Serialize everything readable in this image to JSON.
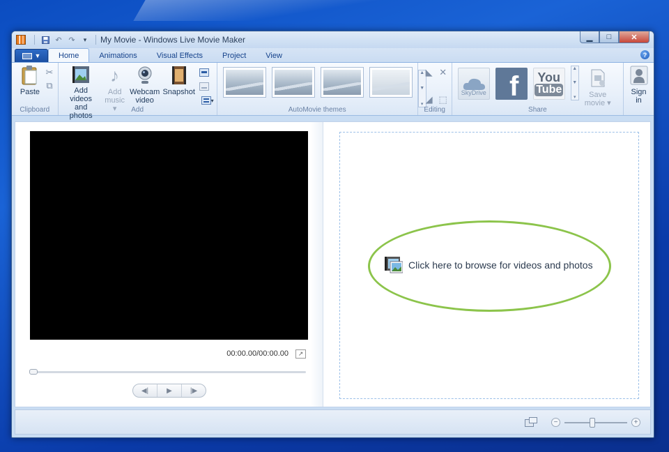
{
  "window": {
    "title": "My Movie - Windows Live Movie Maker"
  },
  "qat": {
    "icons": [
      "save-icon",
      "undo-icon",
      "redo-icon",
      "customize-qat-icon"
    ]
  },
  "tabs": [
    "Home",
    "Animations",
    "Visual Effects",
    "Project",
    "View"
  ],
  "ribbon": {
    "clipboard": {
      "label": "Clipboard",
      "paste": "Paste"
    },
    "add": {
      "label": "Add",
      "add_videos": "Add videos\nand photos",
      "add_videos_l1": "Add videos",
      "add_videos_l2": "and photos",
      "add_music_l1": "Add",
      "add_music_l2": "music",
      "webcam_l1": "Webcam",
      "webcam_l2": "video",
      "snapshot": "Snapshot"
    },
    "automovie": {
      "label": "AutoMovie themes"
    },
    "editing": {
      "label": "Editing"
    },
    "share": {
      "label": "Share",
      "skydrive": "SkyDrive",
      "facebook": "f",
      "youtube_l1": "You",
      "youtube_l2": "Tube",
      "save_movie_l1": "Save",
      "save_movie_l2": "movie"
    },
    "signin": {
      "l1": "Sign",
      "l2": "in"
    }
  },
  "preview": {
    "timecode": "00:00.00/00:00.00"
  },
  "storyboard": {
    "browse_text": "Click here to browse for videos and photos",
    "highlight_color": "#8cc44b"
  },
  "statusbar": {
    "zoom_out": "−",
    "zoom_in": "+"
  }
}
